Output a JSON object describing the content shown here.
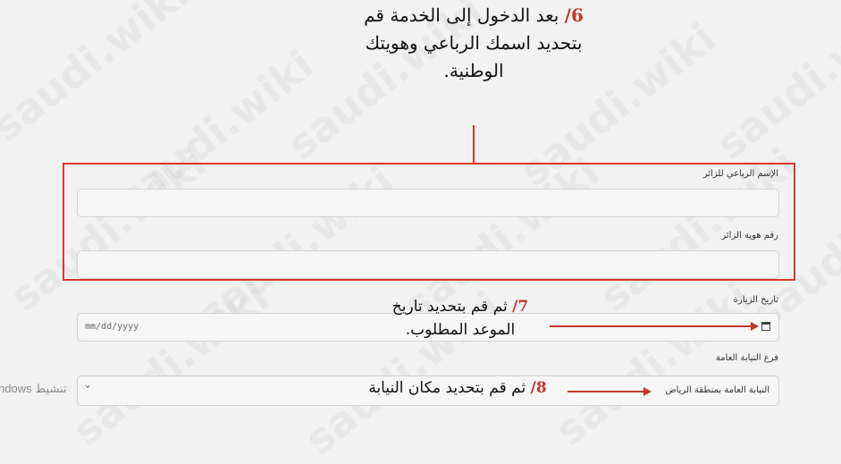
{
  "watermark": "saudi.wiki",
  "step6": {
    "number": "6/",
    "line1": "بعد الدخول إلى الخدمة قم",
    "line2": "بتحديد اسمك الرباعي وهويتك",
    "line3": "الوطنية."
  },
  "step7": {
    "number": "7/",
    "line1": "ثم قم بتحديد تاريخ",
    "line2": "الموعد المطلوب."
  },
  "step8": {
    "number": "8/",
    "text": "ثم قم بتحديد مكان النيابة"
  },
  "form": {
    "full_name_label": "الإسم الرباعي للزائر",
    "visitor_id_label": "رقم هوية الزائر",
    "visit_date_label": "تاريخ الزيارة",
    "visit_date_placeholder": "mm/dd/yyyy",
    "branch_label": "فرع النيابة العامة",
    "branch_value": "النيابة العامة بمنطقة الرياض"
  },
  "os_overlay": {
    "line1": "ndows تنشيط"
  }
}
